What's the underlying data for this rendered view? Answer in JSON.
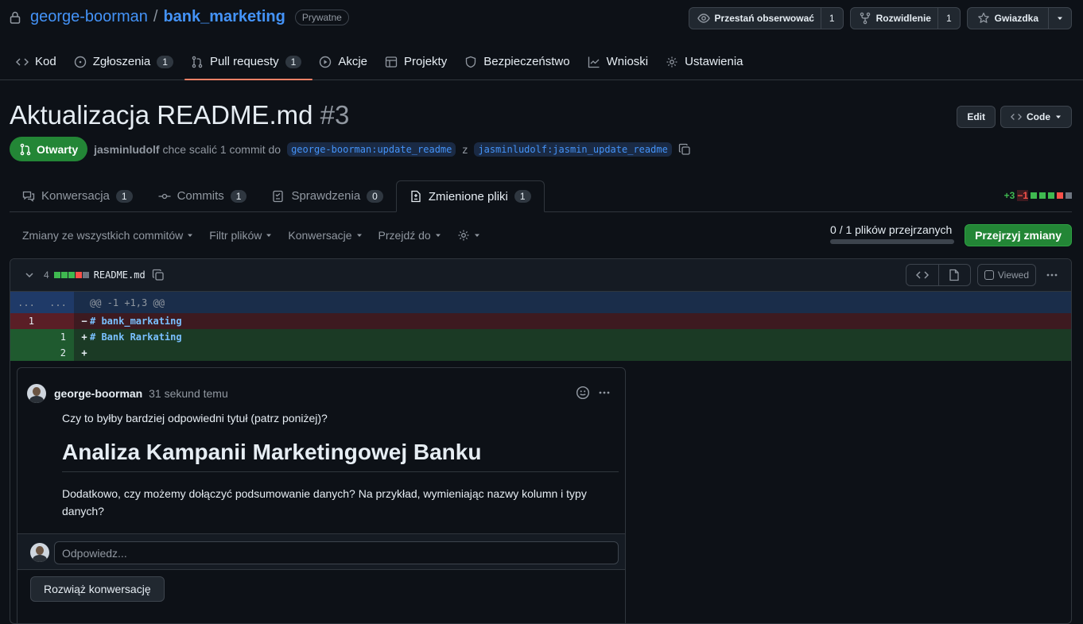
{
  "repo": {
    "owner": "george-boorman",
    "separator": "/",
    "name": "bank_marketing",
    "visibility": "Prywatne"
  },
  "header_buttons": {
    "watch": {
      "label": "Przestań obserwować",
      "count": "1"
    },
    "fork": {
      "label": "Rozwidlenie",
      "count": "1"
    },
    "star": {
      "label": "Gwiazdka"
    }
  },
  "nav": [
    {
      "label": "Kod",
      "icon": "code-icon"
    },
    {
      "label": "Zgłoszenia",
      "icon": "issue-icon",
      "count": "1"
    },
    {
      "label": "Pull requesty",
      "icon": "pull-request-icon",
      "count": "1",
      "active": true
    },
    {
      "label": "Akcje",
      "icon": "play-icon"
    },
    {
      "label": "Projekty",
      "icon": "table-icon"
    },
    {
      "label": "Bezpieczeństwo",
      "icon": "shield-icon"
    },
    {
      "label": "Wnioski",
      "icon": "graph-icon"
    },
    {
      "label": "Ustawienia",
      "icon": "gear-icon"
    }
  ],
  "pr": {
    "title": "Aktualizacja README.md",
    "number": "#3",
    "edit_label": "Edit",
    "code_label": "Code",
    "state": "Otwarty",
    "author": "jasminludolf",
    "merge_text": "chce scalić 1 commit do",
    "base_branch": "george-boorman:update_readme",
    "from_word": "z",
    "head_branch": "jasminludolf:jasmin_update_readme"
  },
  "tabs": [
    {
      "label": "Konwersacja",
      "count": "1",
      "icon": "comment-icon"
    },
    {
      "label": "Commits",
      "count": "1",
      "icon": "commit-icon"
    },
    {
      "label": "Sprawdzenia",
      "count": "0",
      "icon": "checklist-icon"
    },
    {
      "label": "Zmienione pliki",
      "count": "1",
      "icon": "file-diff-icon",
      "active": true
    }
  ],
  "diffstat": {
    "additions": "+3",
    "deletions": "−1"
  },
  "toolbar": {
    "changes_from": "Zmiany ze wszystkich commitów",
    "file_filter": "Filtr plików",
    "conversations": "Konwersacje",
    "jump_to": "Przejdź do",
    "reviewed_count": "0",
    "reviewed_total": "/ 1 plików przejrzanych",
    "reviewed_fraction": 0,
    "review_button": "Przejrzyj zmiany"
  },
  "file": {
    "changed_lines": "4",
    "name": "README.md",
    "viewed_label": "Viewed",
    "hunk_left": "...",
    "hunk_right": "...",
    "hunk_header": "@@ -1 +1,3 @@",
    "lines": [
      {
        "type": "del",
        "old": "1",
        "new": "",
        "sign": "−",
        "code": "# bank_markating"
      },
      {
        "type": "add",
        "old": "",
        "new": "1",
        "sign": "+",
        "code": "# Bank Rarkating"
      },
      {
        "type": "add",
        "old": "",
        "new": "2",
        "sign": "+",
        "code": ""
      }
    ]
  },
  "comment": {
    "author": "george-boorman",
    "time": "31 sekund temu",
    "text1": "Czy to byłby bardziej odpowiedni tytuł (patrz poniżej)?",
    "heading": "Analiza Kampanii Marketingowej Banku",
    "text2": "Dodatkowo, czy możemy dołączyć podsumowanie danych? Na przykład, wymieniając nazwy kolumn i typy danych?",
    "reply_placeholder": "Odpowiedz...",
    "resolve_label": "Rozwiąż konwersację"
  },
  "colors": {
    "accent": "#4493f8",
    "open": "#238636",
    "add": "#3fb950",
    "del": "#f85149",
    "active_tab": "#f78166"
  }
}
